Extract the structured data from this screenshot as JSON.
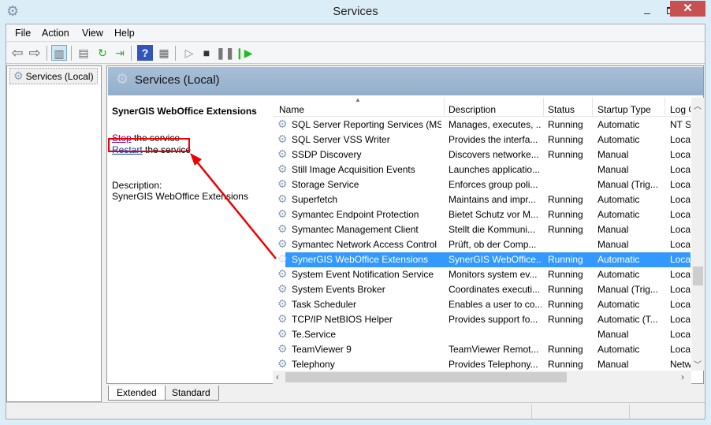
{
  "window": {
    "title": "Services",
    "minimize": "_",
    "close": "✕"
  },
  "menu": [
    "File",
    "Action",
    "View",
    "Help"
  ],
  "tree": {
    "item": "Services (Local)"
  },
  "header": {
    "title": "Services (Local)"
  },
  "detail": {
    "service_name": "SynerGIS WebOffice Extensions",
    "stop_link": "Stop",
    "stop_rest": " the service",
    "restart_link": "Restart",
    "restart_rest": " the service",
    "description_label": "Description:",
    "description": "SynerGIS WebOffice Extensions"
  },
  "columns": [
    "Name",
    "Description",
    "Status",
    "Startup Type",
    "Log On As"
  ],
  "rows": [
    {
      "name": "SQL Server Reporting Services (MS...",
      "desc": "Manages, executes, ...",
      "status": "Running",
      "startup": "Automatic",
      "logon": "NT S"
    },
    {
      "name": "SQL Server VSS Writer",
      "desc": "Provides the interfa...",
      "status": "Running",
      "startup": "Automatic",
      "logon": "Loca"
    },
    {
      "name": "SSDP Discovery",
      "desc": "Discovers networke...",
      "status": "Running",
      "startup": "Manual",
      "logon": "Loca"
    },
    {
      "name": "Still Image Acquisition Events",
      "desc": "Launches applicatio...",
      "status": "",
      "startup": "Manual",
      "logon": "Loca"
    },
    {
      "name": "Storage Service",
      "desc": "Enforces group poli...",
      "status": "",
      "startup": "Manual (Trig...",
      "logon": "Loca"
    },
    {
      "name": "Superfetch",
      "desc": "Maintains and impr...",
      "status": "Running",
      "startup": "Automatic",
      "logon": "Loca"
    },
    {
      "name": "Symantec Endpoint Protection",
      "desc": "Bietet Schutz vor M...",
      "status": "Running",
      "startup": "Automatic",
      "logon": "Loca"
    },
    {
      "name": "Symantec Management Client",
      "desc": "Stellt die Kommuni...",
      "status": "Running",
      "startup": "Manual",
      "logon": "Loca"
    },
    {
      "name": "Symantec Network Access Control",
      "desc": "Prüft, ob der Comp...",
      "status": "",
      "startup": "Manual",
      "logon": "Loca"
    },
    {
      "name": "SynerGIS WebOffice Extensions",
      "desc": "SynerGIS WebOffice...",
      "status": "Running",
      "startup": "Automatic",
      "logon": "Loca",
      "selected": true
    },
    {
      "name": "System Event Notification Service",
      "desc": "Monitors system ev...",
      "status": "Running",
      "startup": "Automatic",
      "logon": "Loca"
    },
    {
      "name": "System Events Broker",
      "desc": "Coordinates executi...",
      "status": "Running",
      "startup": "Manual (Trig...",
      "logon": "Loca"
    },
    {
      "name": "Task Scheduler",
      "desc": "Enables a user to co...",
      "status": "Running",
      "startup": "Automatic",
      "logon": "Loca"
    },
    {
      "name": "TCP/IP NetBIOS Helper",
      "desc": "Provides support fo...",
      "status": "Running",
      "startup": "Automatic (T...",
      "logon": "Loca"
    },
    {
      "name": "Te.Service",
      "desc": "",
      "status": "",
      "startup": "Manual",
      "logon": "Loca"
    },
    {
      "name": "TeamViewer 9",
      "desc": "TeamViewer Remot...",
      "status": "Running",
      "startup": "Automatic",
      "logon": "Loca"
    },
    {
      "name": "Telephony",
      "desc": "Provides Telephony...",
      "status": "Running",
      "startup": "Manual",
      "logon": "Netw"
    }
  ],
  "tabs": [
    "Extended",
    "Standard"
  ],
  "colors": {
    "selection": "#3399ff",
    "annotation": "#ee0000",
    "close": "#c75050"
  }
}
